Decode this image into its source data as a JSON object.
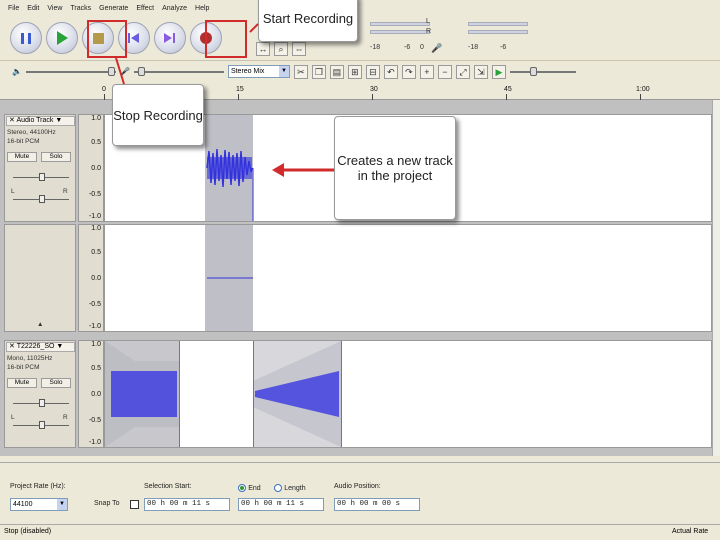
{
  "menu": [
    "File",
    "Edit",
    "View",
    "Tracks",
    "Generate",
    "Effect",
    "Analyze",
    "Help"
  ],
  "callouts": {
    "start": "Start Recording",
    "stop": "Stop Recording",
    "new_track": "Creates a new track in the project"
  },
  "meters": {
    "ticks_top": [
      "-18",
      "-6",
      "0",
      "-18",
      "-6"
    ],
    "label_l": "L",
    "label_r": "R"
  },
  "mixer": {
    "input_source": "Stereo Mix"
  },
  "ruler": {
    "labels": [
      "0",
      "15",
      "30",
      "45",
      "1:00"
    ]
  },
  "tracks": [
    {
      "name": "Audio Track",
      "info1": "Stereo, 44100Hz",
      "info2": "16-bit PCM",
      "mute": "Mute",
      "solo": "Solo",
      "scale": [
        "1.0",
        "0.5",
        "0.0",
        "-0.5",
        "-1.0"
      ],
      "pan_l": "L",
      "pan_r": "R"
    },
    {
      "scale": [
        "1.0",
        "0.5",
        "0.0",
        "-0.5",
        "-1.0"
      ]
    },
    {
      "name": "T22226_SO",
      "info1": "Mono, 11025Hz",
      "info2": "16-bit PCM",
      "mute": "Mute",
      "solo": "Solo",
      "scale": [
        "1.0",
        "0.5",
        "0.0",
        "-0.5",
        "-1.0"
      ],
      "pan_l": "L",
      "pan_r": "R"
    }
  ],
  "selection": {
    "project_rate_label": "Project Rate (Hz):",
    "project_rate": "44100",
    "snap_label": "Snap To",
    "sel_start_label": "Selection Start:",
    "end_label": "End",
    "length_label": "Length",
    "audio_pos_label": "Audio Position:",
    "sel_start": "00 h 00 m 11 s",
    "end_value": "00 h 00 m 11 s",
    "audio_pos": "00 h 00 m 00 s"
  },
  "status": {
    "left": "Stop (disabled)",
    "right": "Actual Rate"
  },
  "colors": {
    "highlight": "#d12b2b",
    "waveform": "#3333dd",
    "selection": "#bfbfc8"
  }
}
